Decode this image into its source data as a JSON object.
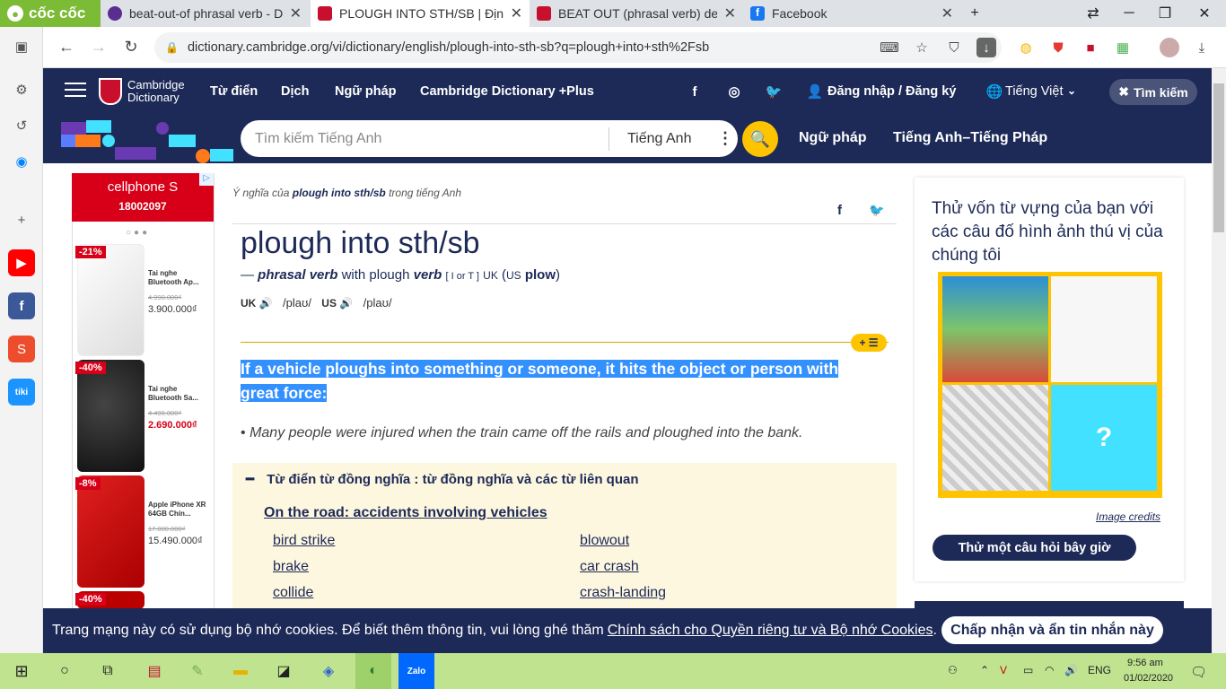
{
  "browser": {
    "brand": "cốc cốc",
    "tabs": [
      {
        "title": "beat-out-of phrasal verb - De",
        "color": "#5c2d91"
      },
      {
        "title": "PLOUGH INTO STH/SB | Định",
        "color": "#c8102e"
      },
      {
        "title": "BEAT OUT (phrasal verb) defin",
        "color": "#c8102e"
      },
      {
        "title": "Facebook",
        "color": "#1877f2"
      }
    ],
    "url": "dictionary.cambridge.org/vi/dictionary/english/plough-into-sth-sb?q=plough+into+sth%2Fsb"
  },
  "header": {
    "logo_line1": "Cambridge",
    "logo_line2": "Dictionary",
    "nav": [
      "Từ điển",
      "Dịch",
      "Ngữ pháp",
      "Cambridge Dictionary +Plus"
    ],
    "login": "Đăng nhập / Đăng ký",
    "language": "Tiếng Việt",
    "search_button": "Tìm kiếm"
  },
  "searchbar": {
    "placeholder": "Tìm kiếm Tiếng Anh",
    "dictionary": "Tiếng Anh",
    "link1": "Ngữ pháp",
    "link2": "Tiếng Anh–Tiếng Pháp"
  },
  "ad": {
    "brand": "cellphone S",
    "phone": "18002097",
    "products": [
      {
        "discount": "-21%",
        "name": "Tai nghe Bluetooth Ap...",
        "old": "4.990.000₫",
        "price": "3.900.000₫",
        "sale": false
      },
      {
        "discount": "-40%",
        "name": "Tai nghe Bluetooth Sa...",
        "old": "4.490.000₫",
        "price": "2.690.000₫",
        "sale": true
      },
      {
        "discount": "-8%",
        "name": "Apple iPhone XR 64GB Chín...",
        "old": "17.000.000₫",
        "price": "15.490.000₫",
        "sale": false
      },
      {
        "discount": "-40%",
        "name": "",
        "old": "",
        "price": "",
        "sale": false
      }
    ]
  },
  "entry": {
    "meaning_prefix": "Ý nghĩa của",
    "meaning_word": "plough into sth/sb",
    "meaning_suffix": "trong tiếng Anh",
    "headword": "plough into sth/sb",
    "pos": "phrasal verb",
    "with_text": "with plough",
    "verb": "verb",
    "grammar": "[ I or T ]",
    "uk": "UK",
    "us_label": "US",
    "us_variant": "plow",
    "uk_pron": "/plaʊ/",
    "us_pron": "/plaʊ/",
    "definition": "If a vehicle ploughs into something or someone, it hits the object or person with great force:",
    "example": "Many people were injured when the train came off the rails and ploughed into the bank."
  },
  "thesaurus": {
    "title": "Từ điển từ đồng nghĩa : từ đồng nghĩa và các từ liên quan",
    "topic": "On the road: accidents involving vehicles",
    "words_left": [
      "bird strike",
      "brake",
      "collide"
    ],
    "words_right": [
      "blowout",
      "car crash",
      "crash-landing"
    ]
  },
  "quiz": {
    "title": "Thử vốn từ vựng của bạn với các câu đố hình ảnh thú vị của chúng tôi",
    "credits": "Image credits",
    "button": "Thử một câu hỏi bây giờ"
  },
  "cookie": {
    "text": "Trang mạng này có sử dụng bộ nhớ cookies. Để biết thêm thông tin, vui lòng ghé thăm",
    "link": "Chính sách cho Quyền riêng tư và Bộ nhớ Cookies",
    "accept": "Chấp nhận và ẩn tin nhắn này"
  },
  "taskbar": {
    "lang": "ENG",
    "time": "9:56 am",
    "date": "01/02/2020"
  }
}
